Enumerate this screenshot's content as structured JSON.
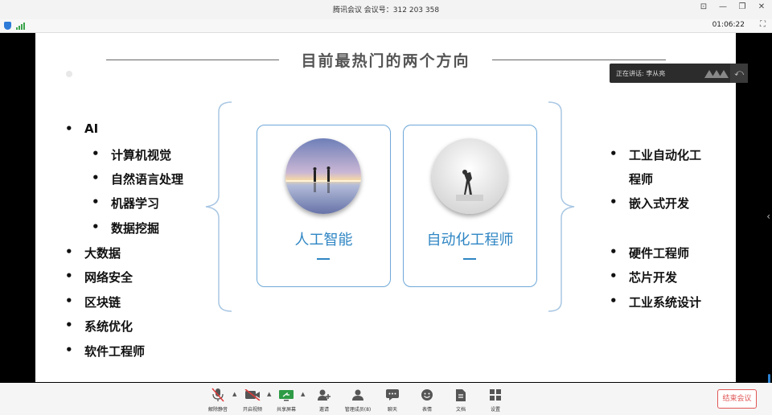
{
  "window": {
    "title": "腾讯会议 会议号：312 203 358",
    "controls": [
      "pin-icon",
      "minimize-icon",
      "restore-icon",
      "close-icon"
    ],
    "timer": "01:06:22"
  },
  "slide": {
    "heading": "目前最热门的两个方向",
    "left_list": [
      {
        "text": "AI",
        "level": 1
      },
      {
        "text": "计算机视觉",
        "level": 2
      },
      {
        "text": "自然语言处理",
        "level": 2
      },
      {
        "text": "机器学习",
        "level": 2
      },
      {
        "text": "数据挖掘",
        "level": 2
      },
      {
        "text": "大数据",
        "level": 1
      },
      {
        "text": "网络安全",
        "level": 1
      },
      {
        "text": "区块链",
        "level": 1
      },
      {
        "text": "系统优化",
        "level": 1
      },
      {
        "text": "软件工程师",
        "level": 1
      }
    ],
    "cards": [
      {
        "label": "人工智能",
        "dash": "—"
      },
      {
        "label": "自动化工程师",
        "dash": "—"
      }
    ],
    "right_list": [
      {
        "text": "工业自动化工"
      },
      {
        "text": "程师",
        "continuation": true
      },
      {
        "text": "嵌入式开发"
      },
      {
        "text": "硬件工程师"
      },
      {
        "text": "芯片开发"
      },
      {
        "text": "工业系统设计"
      }
    ],
    "bullet": "•"
  },
  "speaking_bar": {
    "text": "正在讲话: 李从亮"
  },
  "toolbar": {
    "items": [
      {
        "label": "解除静音",
        "icon": "mic-muted-icon"
      },
      {
        "label": "开启视频",
        "icon": "video-off-icon"
      },
      {
        "label": "共享屏幕",
        "icon": "screen-share-icon"
      },
      {
        "label": "邀请",
        "icon": "invite-icon"
      },
      {
        "label": "管理成员(8)",
        "icon": "members-icon"
      },
      {
        "label": "聊天",
        "icon": "chat-icon"
      },
      {
        "label": "表情",
        "icon": "emoji-icon"
      },
      {
        "label": "文档",
        "icon": "document-icon"
      },
      {
        "label": "设置",
        "icon": "apps-icon"
      }
    ],
    "end_button": "结束会议"
  },
  "colors": {
    "accent": "#2f86c4",
    "card_border": "#6ea8d8",
    "end_red": "#e05555"
  }
}
